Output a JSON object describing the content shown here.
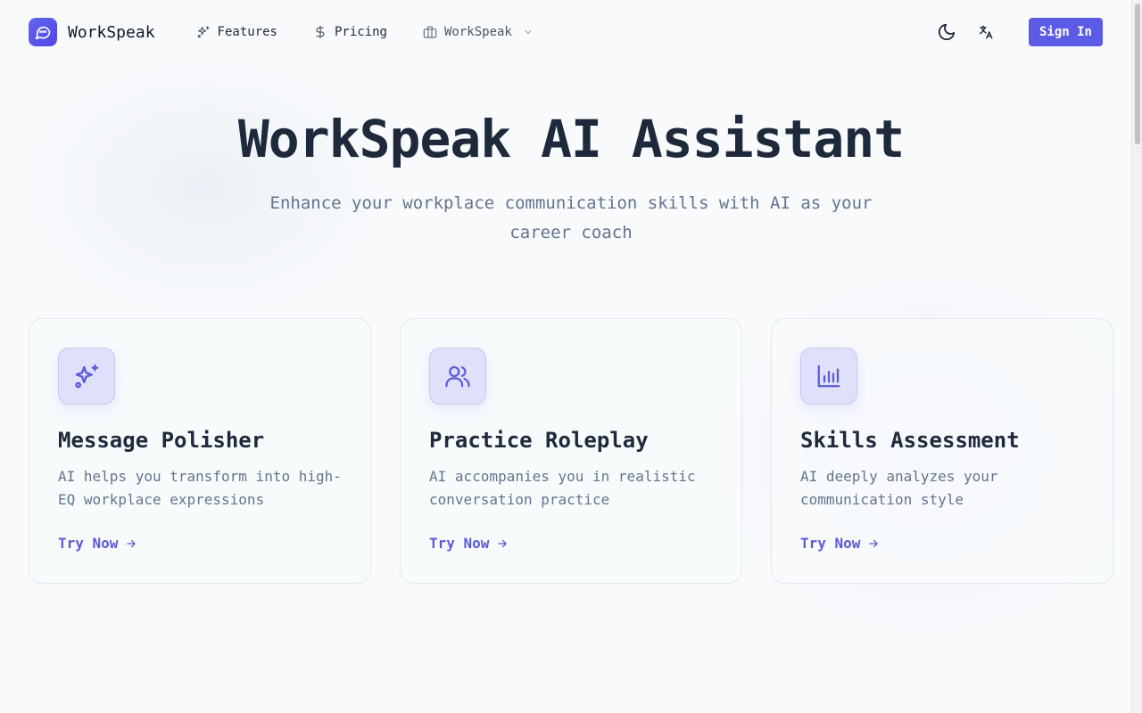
{
  "brand": {
    "name": "WorkSpeak"
  },
  "nav": {
    "features": "Features",
    "pricing": "Pricing",
    "workspeak": "WorkSpeak"
  },
  "header": {
    "sign_in": "Sign In"
  },
  "hero": {
    "title": "WorkSpeak AI Assistant",
    "subtitle": "Enhance your workplace communication skills with AI as your career coach"
  },
  "cards": [
    {
      "icon": "sparkles-icon",
      "title": "Message Polisher",
      "description": "AI helps you transform into high-EQ workplace expressions",
      "link": "Try Now"
    },
    {
      "icon": "users-icon",
      "title": "Practice Roleplay",
      "description": "AI accompanies you in realistic conversation practice",
      "link": "Try Now"
    },
    {
      "icon": "bar-chart-icon",
      "title": "Skills Assessment",
      "description": "AI deeply analyzes your communication style",
      "link": "Try Now"
    }
  ],
  "colors": {
    "accent": "#5b5be6",
    "card_icon_bg": "#e0e0fb",
    "title": "#1e293b",
    "muted": "#64748b"
  }
}
